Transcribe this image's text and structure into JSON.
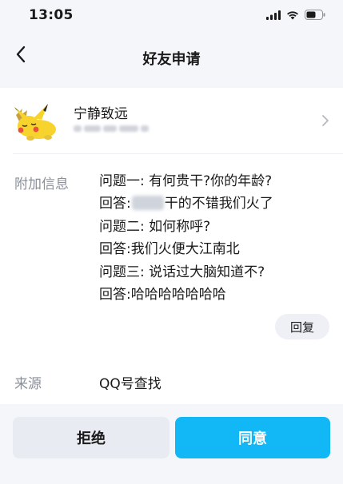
{
  "status_bar": {
    "time": "13:05",
    "icons": [
      "signal-icon",
      "wifi-icon",
      "battery-icon"
    ]
  },
  "nav": {
    "title": "好友申请",
    "back_icon": "back-arrow-icon"
  },
  "profile": {
    "name": "宁静致远",
    "avatar_icon": "pikachu-avatar",
    "chevron_icon": "chevron-right-icon"
  },
  "extra_info": {
    "label": "附加信息",
    "lines": [
      {
        "text": "问题一: 有何贵干?你的年龄?"
      },
      {
        "prefix": "回答:",
        "suffix": "干的不错我们火了"
      },
      {
        "text": "问题二: 如何称呼?"
      },
      {
        "text": "回答:我们火便大江南北"
      },
      {
        "text": "问题三: 说话过大脑知道不?"
      },
      {
        "text": "回答:哈哈哈哈哈哈哈"
      }
    ],
    "reply_label": "回复"
  },
  "source": {
    "label": "来源",
    "value": "QQ号查找"
  },
  "actions": {
    "reject_label": "拒绝",
    "agree_label": "同意"
  },
  "colors": {
    "accent": "#12b7f5",
    "background": "#f5f6fa",
    "secondary_button": "#e9ebf2",
    "label_gray": "#8a8f99"
  }
}
